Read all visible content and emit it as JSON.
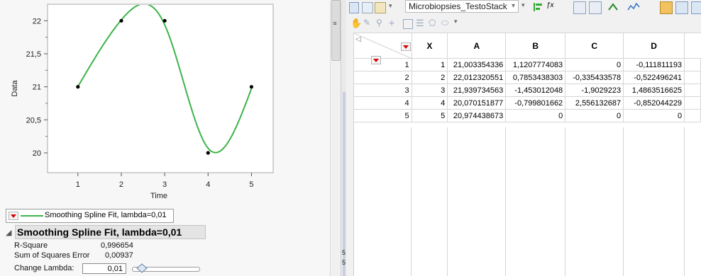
{
  "chart_data": {
    "type": "scatter",
    "title": "",
    "xlabel": "Time",
    "ylabel": "Data",
    "x_ticks": [
      "1",
      "2",
      "3",
      "4",
      "5"
    ],
    "y_ticks": [
      "20",
      "20,5",
      "21",
      "21,5",
      "22"
    ],
    "xlim": [
      0.3,
      5.5
    ],
    "ylim": [
      19.7,
      22.25
    ],
    "points": [
      {
        "x": 1,
        "y": 21.0
      },
      {
        "x": 2,
        "y": 22.0
      },
      {
        "x": 3,
        "y": 22.0
      },
      {
        "x": 4,
        "y": 20.0
      },
      {
        "x": 5,
        "y": 21.0
      }
    ],
    "spline_series": {
      "name": "Smoothing Spline Fit, lambda=0,01",
      "color": "#3db34a",
      "a": [
        21.003354336,
        22.012320551,
        21.939734563,
        20.070151877,
        20.974438673
      ],
      "b": [
        1.1207774083,
        0.7853438303,
        -1.453012048,
        -0.799801662,
        0
      ],
      "c": [
        0,
        -0.335433578,
        -1.9029223,
        2.556132687,
        0
      ],
      "d": [
        -0.111811193,
        -0.522496241,
        1.4863516625,
        -0.852044229,
        0
      ]
    }
  },
  "legend": {
    "label": "Smoothing Spline Fit, lambda=0,01"
  },
  "fit_report": {
    "title": "Smoothing Spline Fit, lambda=0,01",
    "rsq_label": "R-Square",
    "rsq_value": "0,996654",
    "sse_label": "Sum of Squares Error",
    "sse_value": "0,00937",
    "lambda_label": "Change Lambda:",
    "lambda_value": "0,01",
    "lambda_slider_position": 0.15
  },
  "data_table": {
    "table_name": "Microbiopsies_TestoStack",
    "columns": [
      "X",
      "A",
      "B",
      "C",
      "D"
    ],
    "rows": [
      {
        "row": "1",
        "X": "1",
        "A": "21,003354336",
        "B": "1,1207774083",
        "C": "0",
        "D": "-0,111811193"
      },
      {
        "row": "2",
        "X": "2",
        "A": "22,012320551",
        "B": "0,7853438303",
        "C": "-0,335433578",
        "D": "-0,522496241"
      },
      {
        "row": "3",
        "X": "3",
        "A": "21,939734563",
        "B": "-1,453012048",
        "C": "-1,9029223",
        "D": "1,4863516625"
      },
      {
        "row": "4",
        "X": "4",
        "A": "20,070151877",
        "B": "-0,799801662",
        "C": "2,556132687",
        "D": "-0,852044229"
      },
      {
        "row": "5",
        "X": "5",
        "A": "20,974438673",
        "B": "0",
        "C": "0",
        "D": "0"
      }
    ]
  },
  "sidebar_digits": [
    "5",
    "5"
  ],
  "colors": {
    "curve": "#3db34a",
    "point": "#000000",
    "red_triangle": "#dd0000"
  }
}
